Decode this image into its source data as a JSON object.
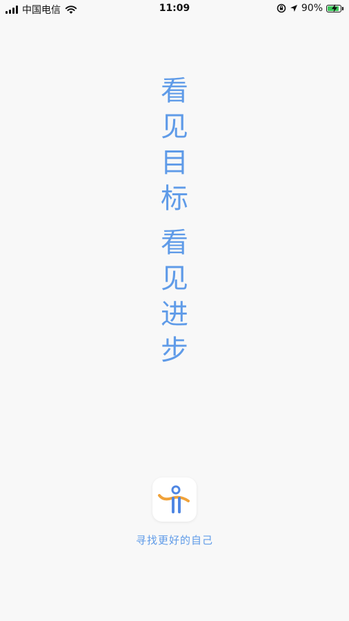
{
  "status_bar": {
    "carrier": "中国电信",
    "time": "11:09",
    "battery_percent": "90%",
    "icons": [
      "signal-icon",
      "wifi-icon",
      "rotation-lock-icon",
      "location-arrow-icon",
      "battery-charging-icon"
    ]
  },
  "slogan": {
    "line1": [
      "看",
      "见",
      "目",
      "标"
    ],
    "line2": [
      "看",
      "见",
      "进",
      "步"
    ]
  },
  "app": {
    "icon": "app-logo-icon",
    "tagline": "寻找更好的自己"
  },
  "colors": {
    "accent": "#5f9be8",
    "logo_orange": "#f0a23a",
    "logo_blue": "#4f86e3",
    "background": "#f8f8f8"
  }
}
